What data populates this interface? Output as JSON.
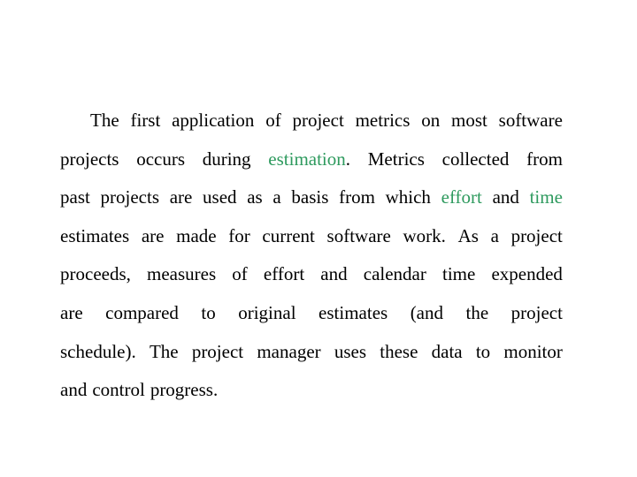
{
  "paragraph": {
    "lines": [
      [
        {
          "t": "The first application of project metrics on most software"
        }
      ],
      [
        {
          "t": "projects occurs during "
        },
        {
          "t": "estimation",
          "hl": true
        },
        {
          "t": ". Metrics collected from"
        }
      ],
      [
        {
          "t": "past projects are used as a basis from which "
        },
        {
          "t": "effort",
          "hl": true
        },
        {
          "t": " and "
        },
        {
          "t": "time",
          "hl": true
        }
      ],
      [
        {
          "t": "estimates are made for current software work. As a project"
        }
      ],
      [
        {
          "t": "proceeds, measures of effort and calendar time expended"
        }
      ],
      [
        {
          "t": "are compared to original estimates (and the project"
        }
      ],
      [
        {
          "t": "schedule). The project manager uses these data to monitor"
        }
      ],
      [
        {
          "t": "and control progress."
        }
      ]
    ]
  },
  "colors": {
    "highlight": "#2e9a5e",
    "text": "#000000"
  }
}
